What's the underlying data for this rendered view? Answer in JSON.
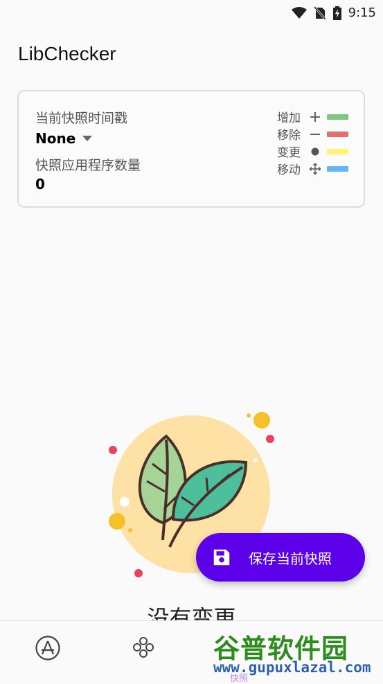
{
  "status_bar": {
    "time": "9:15"
  },
  "app_bar": {
    "title": "LibChecker"
  },
  "snapshot_card": {
    "timestamp_label": "当前快照时间戳",
    "timestamp_value": "None",
    "app_count_label": "快照应用程序数量",
    "app_count_value": "0",
    "legend": [
      {
        "label": "增加",
        "symbol": "+",
        "icon": "plus-icon",
        "color": "#7dc77e"
      },
      {
        "label": "移除",
        "symbol": "−",
        "icon": "minus-icon",
        "color": "#e07070"
      },
      {
        "label": "变更",
        "symbol": "●",
        "icon": "dot-icon",
        "color": "#fff176"
      },
      {
        "label": "移动",
        "symbol": "✥",
        "icon": "move-icon",
        "color": "#64b5f6"
      }
    ]
  },
  "empty_state": {
    "text": "没有变更"
  },
  "fab": {
    "label": "保存当前快照",
    "icon": "save-icon"
  },
  "bottom_nav": {
    "items": [
      {
        "icon": "apps-icon"
      },
      {
        "icon": "statistics-icon"
      },
      {
        "icon": "snapshot-icon",
        "label": "快照"
      }
    ]
  },
  "watermark": {
    "title": "谷普软件园",
    "url": "www.gupuxlazal.com"
  },
  "colors": {
    "accent": "#5b00e8",
    "background": "#fafafa"
  }
}
